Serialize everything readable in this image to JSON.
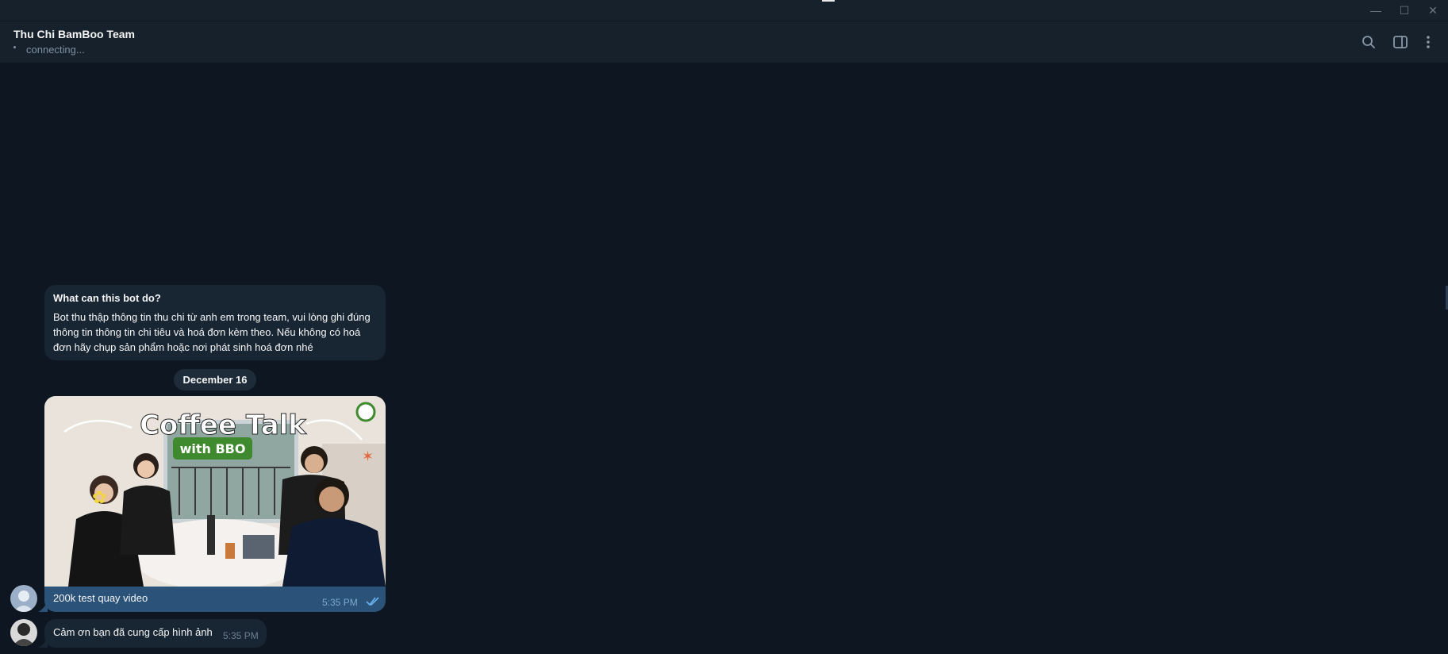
{
  "window": {
    "controls": {
      "minimize": "—",
      "maximize": "☐",
      "close": "✕"
    }
  },
  "header": {
    "title": "Thu Chi BamBoo Team",
    "status": "connecting...",
    "icons": [
      "search-icon",
      "sidebar-toggle-icon",
      "more-vertical-icon"
    ]
  },
  "bot_info": {
    "title": "What can this bot do?",
    "text": "Bot thu thập thông tin thu chi từ anh em trong team, vui lòng ghi đúng thông tin thông tin chi tiêu và hoá đơn kèm theo. Nếu không có hoá đơn hãy chụp sản phẩm hoặc nơi phát sinh hoá đơn nhé"
  },
  "date_separator": "December 16",
  "messages": [
    {
      "direction": "outgoing",
      "has_photo": true,
      "photo_text": {
        "line1": "Coffee Talk",
        "line2": "with BBO"
      },
      "caption": "200k test quay video",
      "time": "5:35 PM",
      "read": true
    },
    {
      "direction": "incoming",
      "text": "Cảm ơn bạn đã cung cấp hình ảnh",
      "time": "5:35 PM"
    }
  ],
  "colors": {
    "background": "#0e1621",
    "header": "#17212b",
    "bubble_in": "#182533",
    "bubble_out": "#2b5278",
    "accent": "#6ab3f3"
  }
}
